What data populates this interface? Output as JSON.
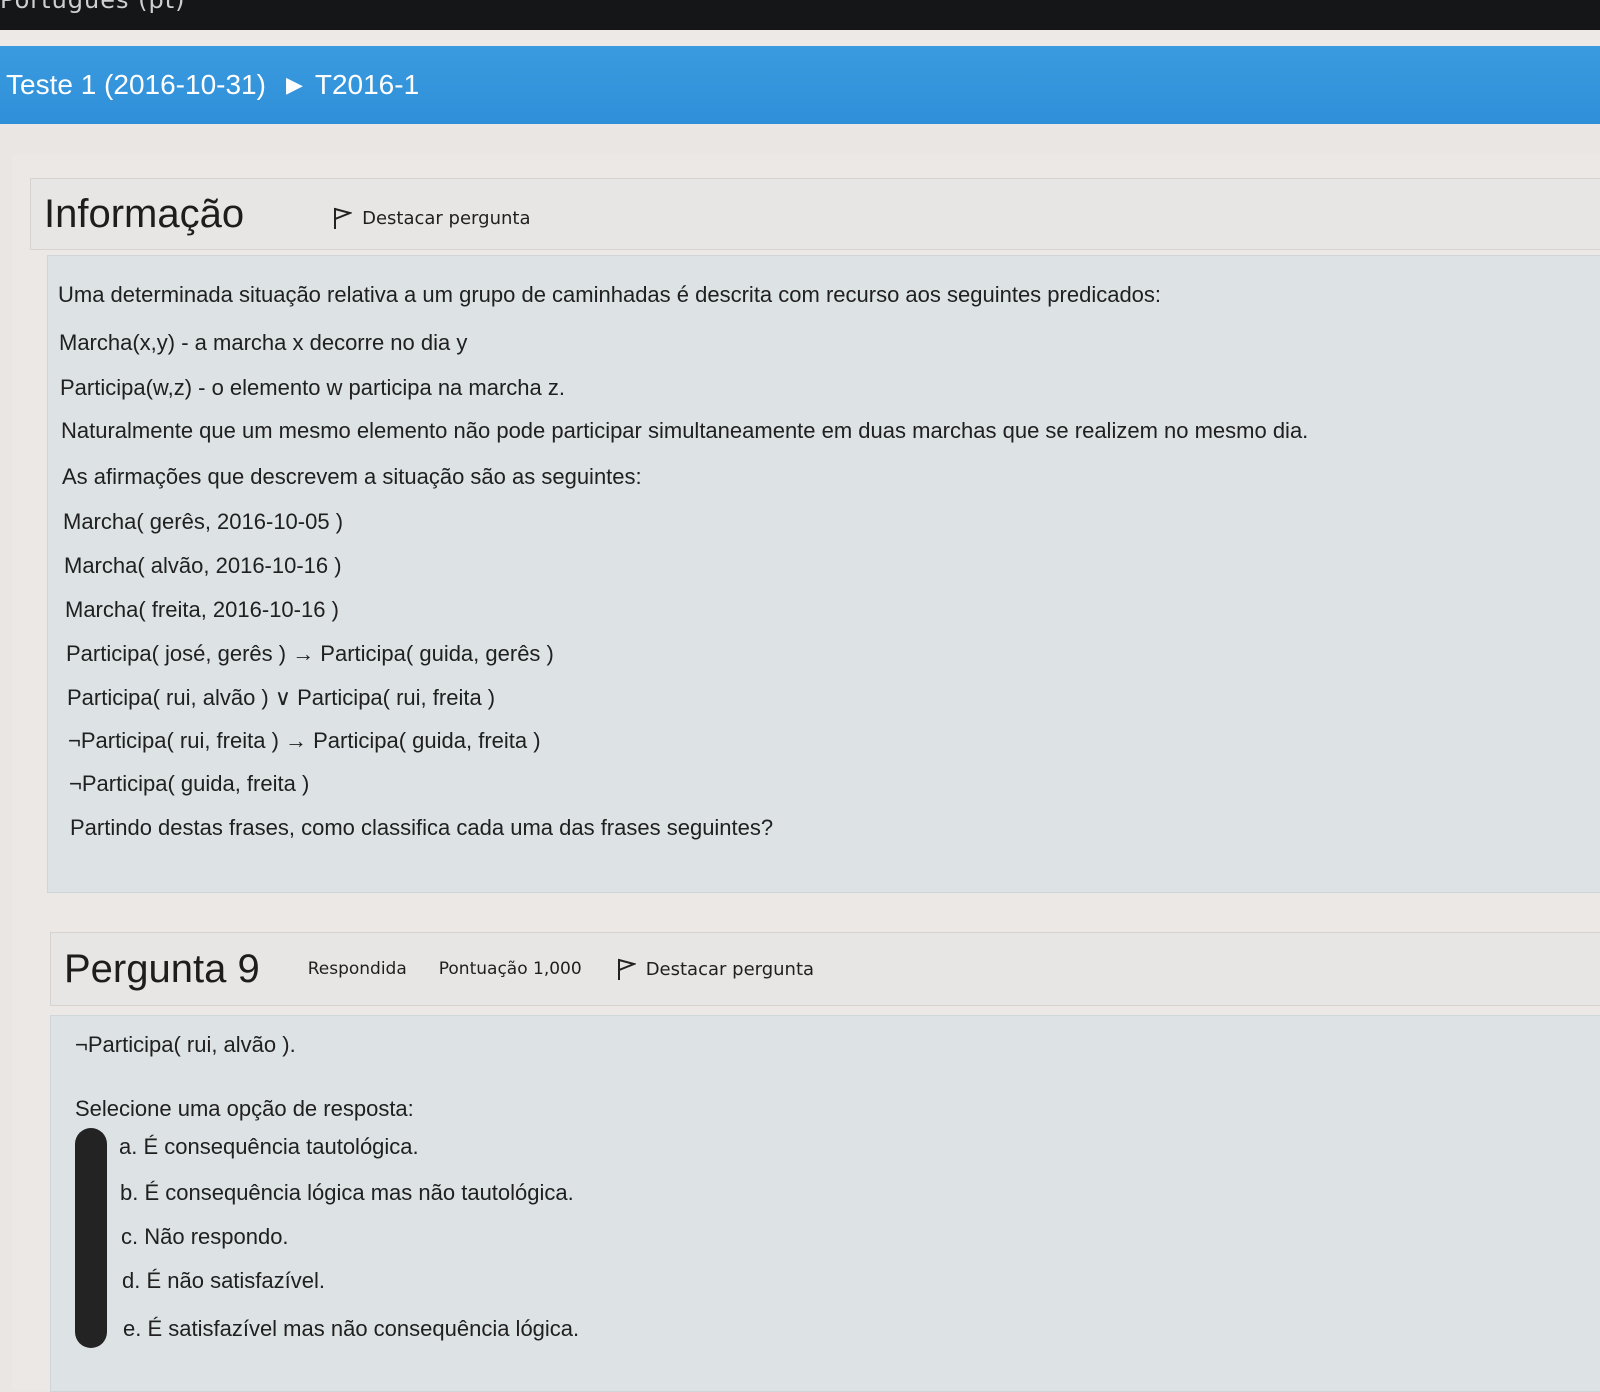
{
  "top_bar": {
    "language": "Português (pt)"
  },
  "breadcrumb": {
    "items": [
      "Teste 1 (2016-10-31)",
      "T2016-1"
    ],
    "separator": "▶"
  },
  "info": {
    "title": "Informação",
    "flag_label": "Destacar pergunta",
    "lines": [
      "Uma determinada situação relativa a um grupo de caminhadas é descrita com recurso aos seguintes predicados:",
      "Marcha(x,y) - a marcha x decorre no dia y",
      "Participa(w,z) - o elemento w participa na marcha z.",
      "Naturalmente que um mesmo elemento não pode participar simultaneamente em duas marchas que se realizem no mesmo dia.",
      "As afirmações que descrevem a situação são as seguintes:",
      "Marcha( gerês, 2016-10-05 )",
      "Marcha( alvão, 2016-10-16 )",
      "Marcha( freita, 2016-10-16 )",
      "Participa( josé, gerês ) → Participa( guida, gerês )",
      "Participa( rui, alvão ) ∨ Participa( rui, freita )",
      "¬Participa( rui, freita ) → Participa( guida, freita )",
      "¬Participa( guida, freita )",
      "Partindo destas frases, como classifica cada uma das frases seguintes?"
    ]
  },
  "question": {
    "title": "Pergunta 9",
    "status": "Respondida",
    "score": "Pontuação 1,000",
    "flag_label": "Destacar pergunta",
    "statement": "¬Participa( rui, alvão ).",
    "prompt": "Selecione uma opção de resposta:",
    "options": [
      "a. É consequência tautológica.",
      "b. É consequência lógica mas não tautológica.",
      "c. Não respondo.",
      "d. É não satisfazível.",
      "e. É satisfazível mas não consequência lógica."
    ]
  },
  "icons": {
    "flag": "flag-icon"
  }
}
